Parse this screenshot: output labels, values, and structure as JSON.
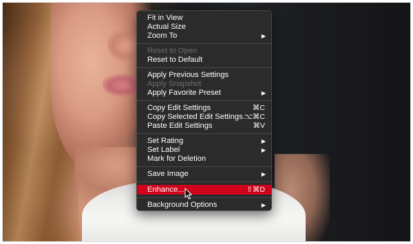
{
  "menu": {
    "groups": [
      [
        {
          "label": "Fit in View",
          "disabled": false
        },
        {
          "label": "Actual Size",
          "disabled": false
        },
        {
          "label": "Zoom To",
          "disabled": false,
          "submenu": true
        }
      ],
      [
        {
          "label": "Reset to Open",
          "disabled": true
        },
        {
          "label": "Reset to Default",
          "disabled": false
        }
      ],
      [
        {
          "label": "Apply Previous Settings",
          "disabled": false
        },
        {
          "label": "Apply Snapshot",
          "disabled": true
        },
        {
          "label": "Apply Favorite Preset",
          "disabled": false,
          "submenu": true
        }
      ],
      [
        {
          "label": "Copy Edit Settings",
          "shortcut": "⌘C",
          "disabled": false
        },
        {
          "label": "Copy Selected Edit Settings...",
          "shortcut": "⌥⌘C",
          "disabled": false
        },
        {
          "label": "Paste Edit Settings",
          "shortcut": "⌘V",
          "disabled": false
        }
      ],
      [
        {
          "label": "Set Rating",
          "disabled": false,
          "submenu": true
        },
        {
          "label": "Set Label",
          "disabled": false,
          "submenu": true
        },
        {
          "label": "Mark for Deletion",
          "disabled": false
        }
      ],
      [
        {
          "label": "Save Image",
          "disabled": false,
          "submenu": true
        }
      ],
      [
        {
          "label": "Enhance...",
          "shortcut": "⇧⌘D",
          "disabled": false,
          "highlighted": true
        }
      ],
      [
        {
          "label": "Background Options",
          "disabled": false,
          "submenu": true
        }
      ]
    ],
    "submenu_arrow": "▶",
    "highlight_color": "#d0021b",
    "background_color": "#2b2b2b",
    "disabled_color": "#6d6d6d"
  },
  "icons": {
    "cursor": "arrow-pointer-icon",
    "submenu": "triangle-right-icon"
  }
}
